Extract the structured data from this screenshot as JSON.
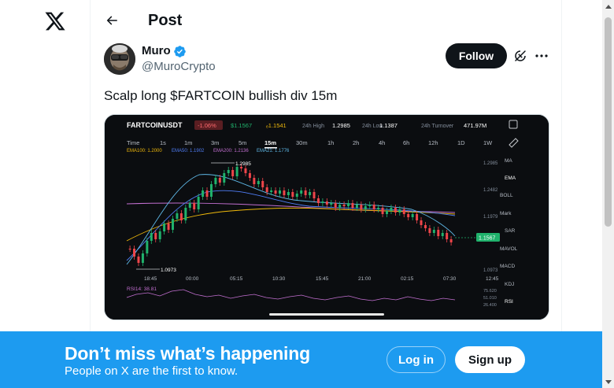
{
  "header": {
    "title": "Post"
  },
  "post": {
    "author_name": "Muro",
    "handle": "@MuroCrypto",
    "follow_label": "Follow",
    "text": "Scalp long $FARTCOIN bullish div 15m"
  },
  "chart_image": {
    "symbol": "FARTCOINUSDT",
    "change": "-1.06%",
    "price": "$1.1567",
    "mark": "ₑ1.1541",
    "high_label": "24h High",
    "high_value": "1.2985",
    "low_label": "24h Low",
    "low_value": "1.1387",
    "turnover_label": "24h Turnover",
    "turnover_value": "471.97M",
    "timeframes": [
      "Time",
      "1s",
      "1m",
      "3m",
      "5m",
      "15m",
      "30m",
      "1h",
      "2h",
      "4h",
      "6h",
      "12h",
      "1D",
      "1W"
    ],
    "active_timeframe": "15m",
    "emas": [
      "EMA100: 1.2000",
      "EMA50: 1.1902",
      "EMA200: 1.2136",
      "EMA21: 1.1776"
    ],
    "peak_label": "1.2985",
    "trough_label": "1.0973",
    "price_axis": [
      "1.2985",
      "1.2482",
      "1.1979",
      "1.0973"
    ],
    "price_tag": "1.1567",
    "time_axis": [
      "18:45",
      "00:00",
      "05:15",
      "10:30",
      "15:45",
      "21:00",
      "02:15",
      "07:30",
      "12:45"
    ],
    "rsi_label": "RSI14: 38.81",
    "rsi_axis": [
      "75.620",
      "51.010",
      "26.400"
    ],
    "indicators": [
      "MA",
      "EMA",
      "BOLL",
      "Mark",
      "SAR",
      "MAVOL",
      "MACD",
      "KDJ",
      "RSI"
    ],
    "colors": {
      "up": "#20b26c",
      "down": "#ef454a",
      "accent": "#f0b90b",
      "background": "#0b0d10"
    }
  },
  "banner": {
    "title": "Don’t miss what’s happening",
    "subtitle": "People on X are the first to know.",
    "login_label": "Log in",
    "signup_label": "Sign up"
  },
  "theme": {
    "brand_blue": "#1d9bf0",
    "text": "#0f1419",
    "muted": "#536471"
  }
}
